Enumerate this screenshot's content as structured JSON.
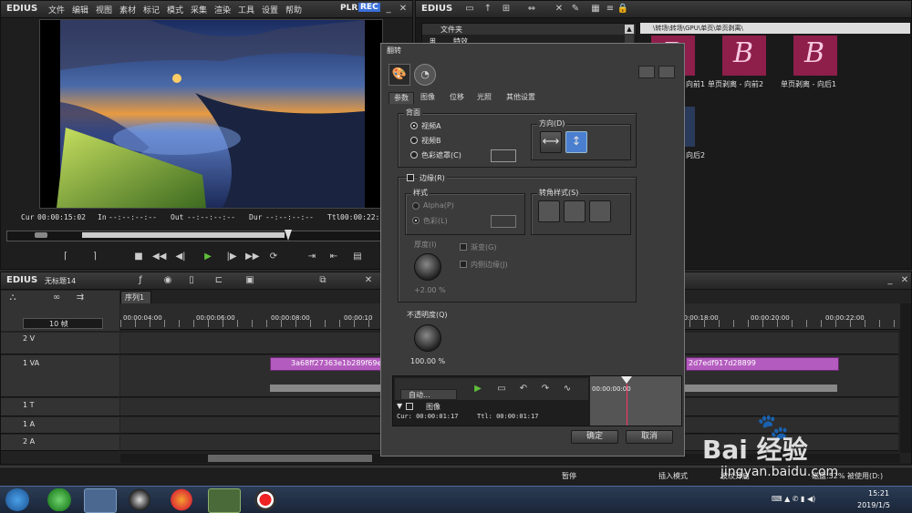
{
  "player": {
    "logo": "EDIUS",
    "menu": [
      "文件",
      "编辑",
      "视图",
      "素材",
      "标记",
      "模式",
      "采集",
      "渲染",
      "工具",
      "设置",
      "帮助"
    ],
    "plr": "PLR",
    "rec": "REC",
    "cur_label": "Cur",
    "cur_value": "00:00:15:02",
    "in_label": "In",
    "in_value": "--:--:--:--",
    "out_label": "Out",
    "out_value": "--:--:--:--",
    "dur_label": "Dur",
    "dur_value": "--:--:--:--",
    "ttl_label": "Ttl",
    "ttl_value": "00:00:22:"
  },
  "bin": {
    "logo": "EDIUS",
    "tree_header": "文件夹",
    "tree_item": "特效",
    "path": "\\转场\\转场\\GPU\\单页\\单页剥离\\",
    "items": [
      {
        "letter": "B",
        "label": "向前1"
      },
      {
        "letter": "B",
        "label": "单页剥离 - 向前2"
      },
      {
        "letter": "B",
        "label": "单页剥离 - 向后1"
      }
    ],
    "extra_label": "向后2"
  },
  "timeline": {
    "logo": "EDIUS",
    "project_name": "无标题14",
    "sequence_tab": "序列1",
    "zoom": "10 帧",
    "ruler": [
      "00:00:04:00",
      "00:00:06:00",
      "00:00:08:00",
      "00:00:10",
      "00:00:18:00",
      "00:00:20:00",
      "00:00:22:00"
    ],
    "tracks": [
      {
        "name": "2 V"
      },
      {
        "name": "1 VA"
      },
      {
        "name": "1 T"
      },
      {
        "name": "1 A"
      },
      {
        "name": "2 A"
      }
    ],
    "clip_left": "3a68ff27363e1b289f69e",
    "clip_right": "2d7edf917d28899"
  },
  "status": {
    "pause": "暂停",
    "insert_mode": "插入模式",
    "ripple": "波纹开启",
    "disk": "磁盘:52% 被使用(D:)"
  },
  "dialog": {
    "title": "翻转",
    "tabs": [
      "参数",
      "图像",
      "位移",
      "光照",
      "其他设置"
    ],
    "background_group": "背面",
    "video_a": "视频A",
    "video_b": "视频B",
    "color_matte": "色彩遮罩(C)",
    "direction_group": "方向(D)",
    "border_check": "边缘(R)",
    "style_group": "样式",
    "alpha": "Alpha(P)",
    "color": "色彩(L)",
    "corner_group": "转角样式(S)",
    "thickness": "厚度(I)",
    "thickness_value": "+2.00 %",
    "gradient": "渐变(G)",
    "inner_border": "内侧边缘(J)",
    "opacity": "不透明度(Q)",
    "opacity_value": "100.00 %",
    "auto": "自动...",
    "track_label": "图像",
    "cur": "Cur: 00:00:01:17",
    "ttl": "Ttl: 00:00:01:17",
    "mini_time": "00:00:00:00",
    "ok": "确定",
    "cancel": "取消"
  },
  "taskbar": {
    "time": "15:21",
    "date": "2019/1/5"
  },
  "watermark": {
    "text": "Bai 经验",
    "url": "jingyan.baidu.com"
  },
  "colors": {
    "accent_green": "#5fbf3a",
    "clip_purple": "#b45bbf",
    "rec_blue": "#3a6fd8",
    "selected_blue": "#4a7fd0"
  }
}
